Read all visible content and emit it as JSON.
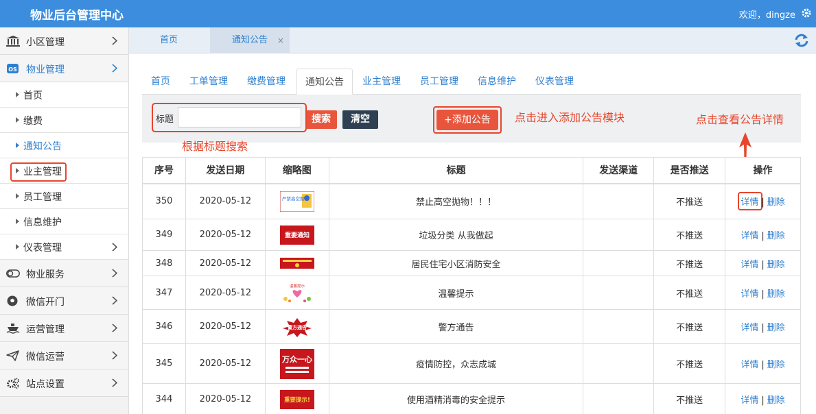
{
  "app": {
    "title": "物业后台管理中心",
    "welcome": "欢迎，dingze"
  },
  "colors": {
    "header": "#3c8dde",
    "accent": "#2f7fcf",
    "danger": "#e8553c",
    "dark_button": "#2e4052",
    "annotation": "#e8452c"
  },
  "sidebar": {
    "items": [
      {
        "label": "小区管理",
        "icon": "building-icon"
      },
      {
        "label": "物业管理",
        "icon": "os-badge-icon"
      }
    ],
    "subitems": [
      {
        "label": "首页"
      },
      {
        "label": "缴费"
      },
      {
        "label": "通知公告"
      },
      {
        "label": "业主管理"
      },
      {
        "label": "员工管理"
      },
      {
        "label": "信息维护"
      },
      {
        "label": "仪表管理"
      }
    ],
    "bottom_items": [
      {
        "label": "物业服务",
        "icon": "toggle-icon"
      },
      {
        "label": "微信开门",
        "icon": "ball-icon"
      },
      {
        "label": "运营管理",
        "icon": "ship-icon"
      },
      {
        "label": "微信运营",
        "icon": "send-icon"
      },
      {
        "label": "站点设置",
        "icon": "gears-icon"
      }
    ]
  },
  "tabs": [
    {
      "label": "首页"
    },
    {
      "label": "通知公告",
      "close": "×"
    }
  ],
  "subtabs": [
    "首页",
    "工单管理",
    "缴费管理",
    "通知公告",
    "业主管理",
    "员工管理",
    "信息维护",
    "仪表管理"
  ],
  "search": {
    "label": "标题",
    "value": "",
    "search_button": "搜索",
    "clear_button": "清空",
    "add_button": "+添加公告"
  },
  "annotations": {
    "search_note": "根据标题搜索",
    "add_note": "点击进入添加公告模块",
    "detail_note": "点击查看公告详情"
  },
  "table": {
    "headers": [
      "序号",
      "发送日期",
      "缩略图",
      "标题",
      "发送渠道",
      "是否推送",
      "操作"
    ],
    "rows": [
      {
        "id": "350",
        "date": "2020-05-12",
        "thumb": "严禁高空抛物",
        "title": "禁止高空抛物！！！",
        "channel": "",
        "push": "不推送",
        "detail": "详情",
        "sep": "|",
        "delete": "删除"
      },
      {
        "id": "349",
        "date": "2020-05-12",
        "thumb": "重要通知",
        "title": "垃圾分类 从我做起",
        "channel": "",
        "push": "不推送",
        "detail": "详情",
        "sep": "|",
        "delete": "删除"
      },
      {
        "id": "348",
        "date": "2020-05-12",
        "thumb": "",
        "title": "居民住宅小区消防安全",
        "channel": "",
        "push": "不推送",
        "detail": "详情",
        "sep": "|",
        "delete": "删除"
      },
      {
        "id": "347",
        "date": "2020-05-12",
        "thumb": "温馨提示",
        "title": "温馨提示",
        "channel": "",
        "push": "不推送",
        "detail": "详情",
        "sep": "|",
        "delete": "删除"
      },
      {
        "id": "346",
        "date": "2020-05-12",
        "thumb": "警方通告",
        "title": "警方通告",
        "channel": "",
        "push": "不推送",
        "detail": "详情",
        "sep": "|",
        "delete": "删除"
      },
      {
        "id": "345",
        "date": "2020-05-12",
        "thumb": "万众一心",
        "title": "疫情防控，众志成城",
        "channel": "",
        "push": "不推送",
        "detail": "详情",
        "sep": "|",
        "delete": "删除"
      },
      {
        "id": "344",
        "date": "2020-05-12",
        "thumb": "重要提示!",
        "title": "使用酒精消毒的安全提示",
        "channel": "",
        "push": "不推送",
        "detail": "详情",
        "sep": "|",
        "delete": "删除"
      }
    ]
  }
}
